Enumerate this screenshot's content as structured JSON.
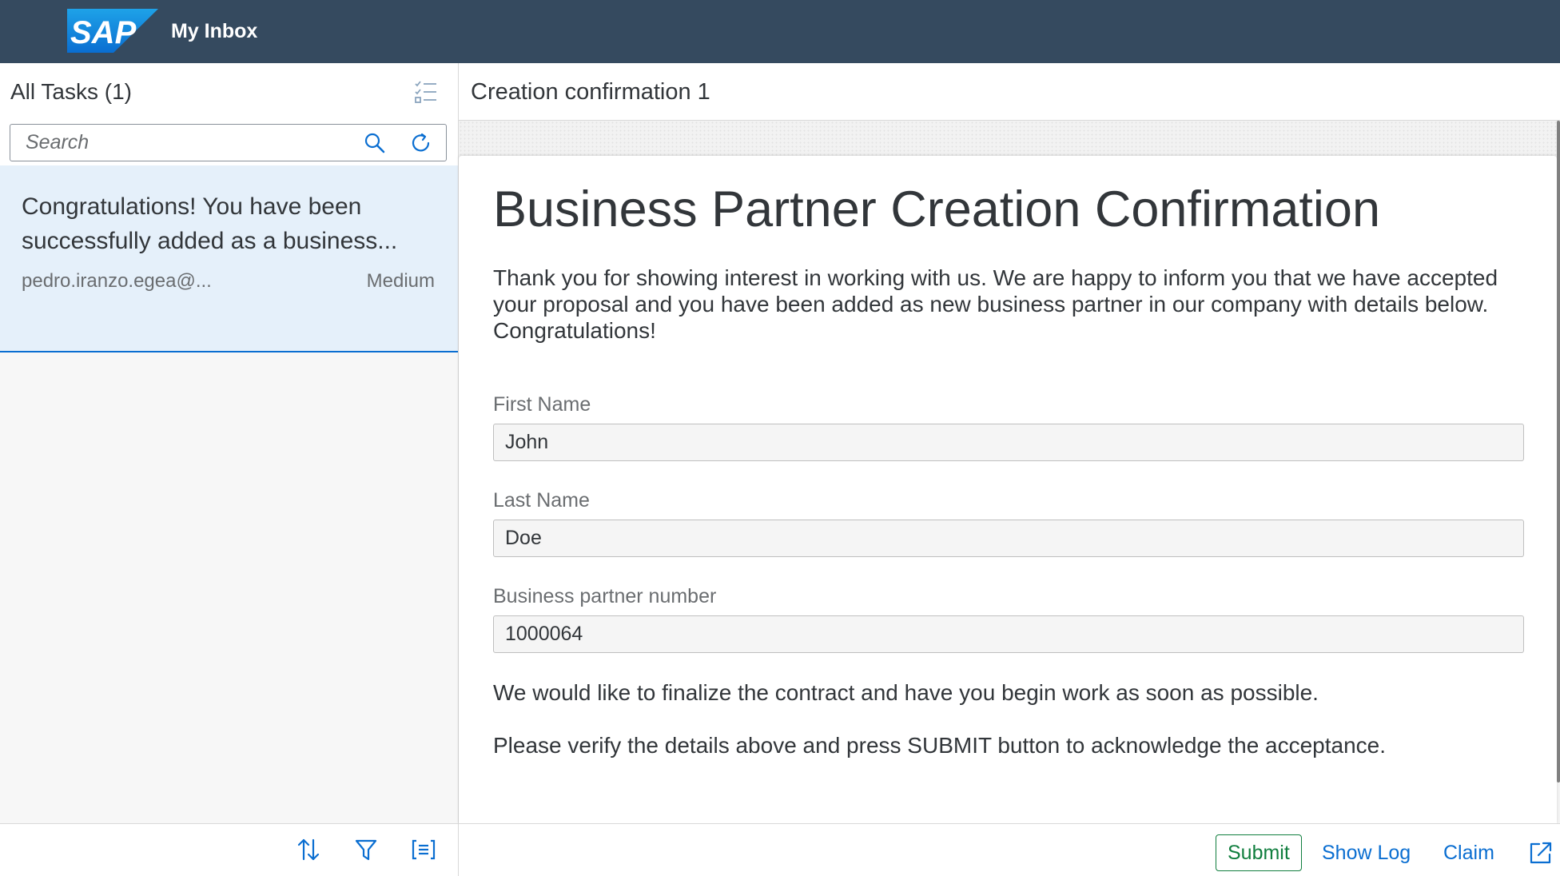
{
  "shell": {
    "title": "My Inbox",
    "logo_text": "SAP"
  },
  "master": {
    "title": "All Tasks (1)",
    "search_placeholder": "Search",
    "tasks": [
      {
        "title": "Congratulations! You have been successfully added as a business...",
        "creator": "pedro.iranzo.egea@...",
        "priority": "Medium"
      }
    ]
  },
  "detail": {
    "header_title": "Creation confirmation 1",
    "form": {
      "title": "Business Partner Creation Confirmation",
      "intro": "Thank you for showing interest in working with us. We are happy to inform you that we have accepted your proposal and you have been added as new business partner in our company with details below. Congratulations!",
      "fields": [
        {
          "label": "First Name",
          "value": "John"
        },
        {
          "label": "Last Name",
          "value": "Doe"
        },
        {
          "label": "Business partner number",
          "value": "1000064"
        }
      ],
      "closing_1": "We would like to finalize the contract and have you begin work as soon as possible.",
      "closing_2": "Please verify the details above and press SUBMIT button to acknowledge the acceptance."
    },
    "footer": {
      "submit_label": "Submit",
      "show_log_label": "Show Log",
      "claim_label": "Claim"
    }
  },
  "colors": {
    "shell_bg": "#354a5f",
    "accent": "#0a6ed1",
    "positive": "#107e3e",
    "selected_item_bg": "#e5f0fa"
  },
  "icons": [
    "sap-logo",
    "multi-select-icon",
    "search-icon",
    "refresh-icon",
    "sort-icon",
    "filter-icon",
    "group-icon",
    "open-external-icon"
  ]
}
